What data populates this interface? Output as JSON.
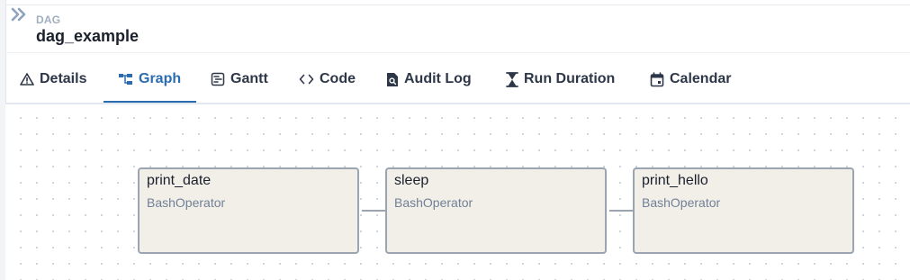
{
  "header": {
    "kicker": "DAG",
    "title": "dag_example"
  },
  "tabs": [
    {
      "label": "Details",
      "icon": "warning-triangle-icon",
      "active": false
    },
    {
      "label": "Graph",
      "icon": "graph-icon",
      "active": true
    },
    {
      "label": "Gantt",
      "icon": "gantt-icon",
      "active": false
    },
    {
      "label": "Code",
      "icon": "code-icon",
      "active": false
    },
    {
      "label": "Audit Log",
      "icon": "audit-log-icon",
      "active": false
    },
    {
      "label": "Run Duration",
      "icon": "hourglass-icon",
      "active": false
    },
    {
      "label": "Calendar",
      "icon": "calendar-icon",
      "active": false
    }
  ],
  "graph": {
    "nodes": [
      {
        "label": "print_date",
        "operator": "BashOperator"
      },
      {
        "label": "sleep",
        "operator": "BashOperator"
      },
      {
        "label": "print_hello",
        "operator": "BashOperator"
      }
    ],
    "edges": [
      {
        "from": "print_date",
        "to": "sleep"
      },
      {
        "from": "sleep",
        "to": "print_hello"
      }
    ]
  },
  "colors": {
    "accent": "#2b6cb0",
    "node_fill": "#f2efe9",
    "node_border": "#9aa5b1",
    "edge": "#9aa5b1"
  }
}
